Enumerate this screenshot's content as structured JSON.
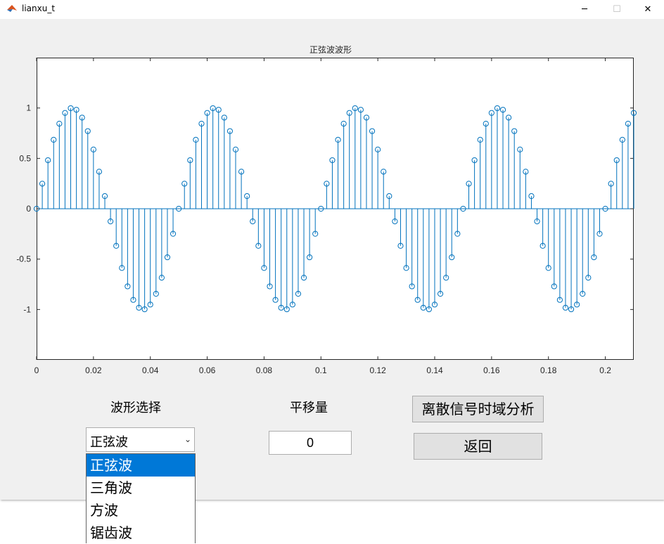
{
  "window": {
    "title": "lianxu_t",
    "minimize": "─",
    "maximize": "☐",
    "close": "✕"
  },
  "plot": {
    "title": "正弦波波形"
  },
  "chart_data": {
    "type": "stem",
    "title": "正弦波波形",
    "xlabel": "",
    "ylabel": "",
    "xlim": [
      0,
      0.21
    ],
    "ylim": [
      -1.5,
      1.5
    ],
    "x_ticks": [
      "0",
      "0.02",
      "0.04",
      "0.06",
      "0.08",
      "0.1",
      "0.12",
      "0.14",
      "0.16",
      "0.18",
      "0.2"
    ],
    "y_ticks": [
      "1",
      "0.5",
      "0",
      "-0.5",
      "-1"
    ],
    "frequency_hz": 20,
    "sample_step": 0.002,
    "x_start": 0,
    "x_end": 0.21,
    "color": "#0072bd"
  },
  "controls": {
    "waveform_label": "波形选择",
    "waveform_selected": "正弦波",
    "waveform_options": [
      "正弦波",
      "三角波",
      "方波",
      "锯齿波"
    ],
    "shift_label": "平移量",
    "shift_value": "0",
    "discrete_button": "离散信号时域分析",
    "back_button": "返回"
  }
}
